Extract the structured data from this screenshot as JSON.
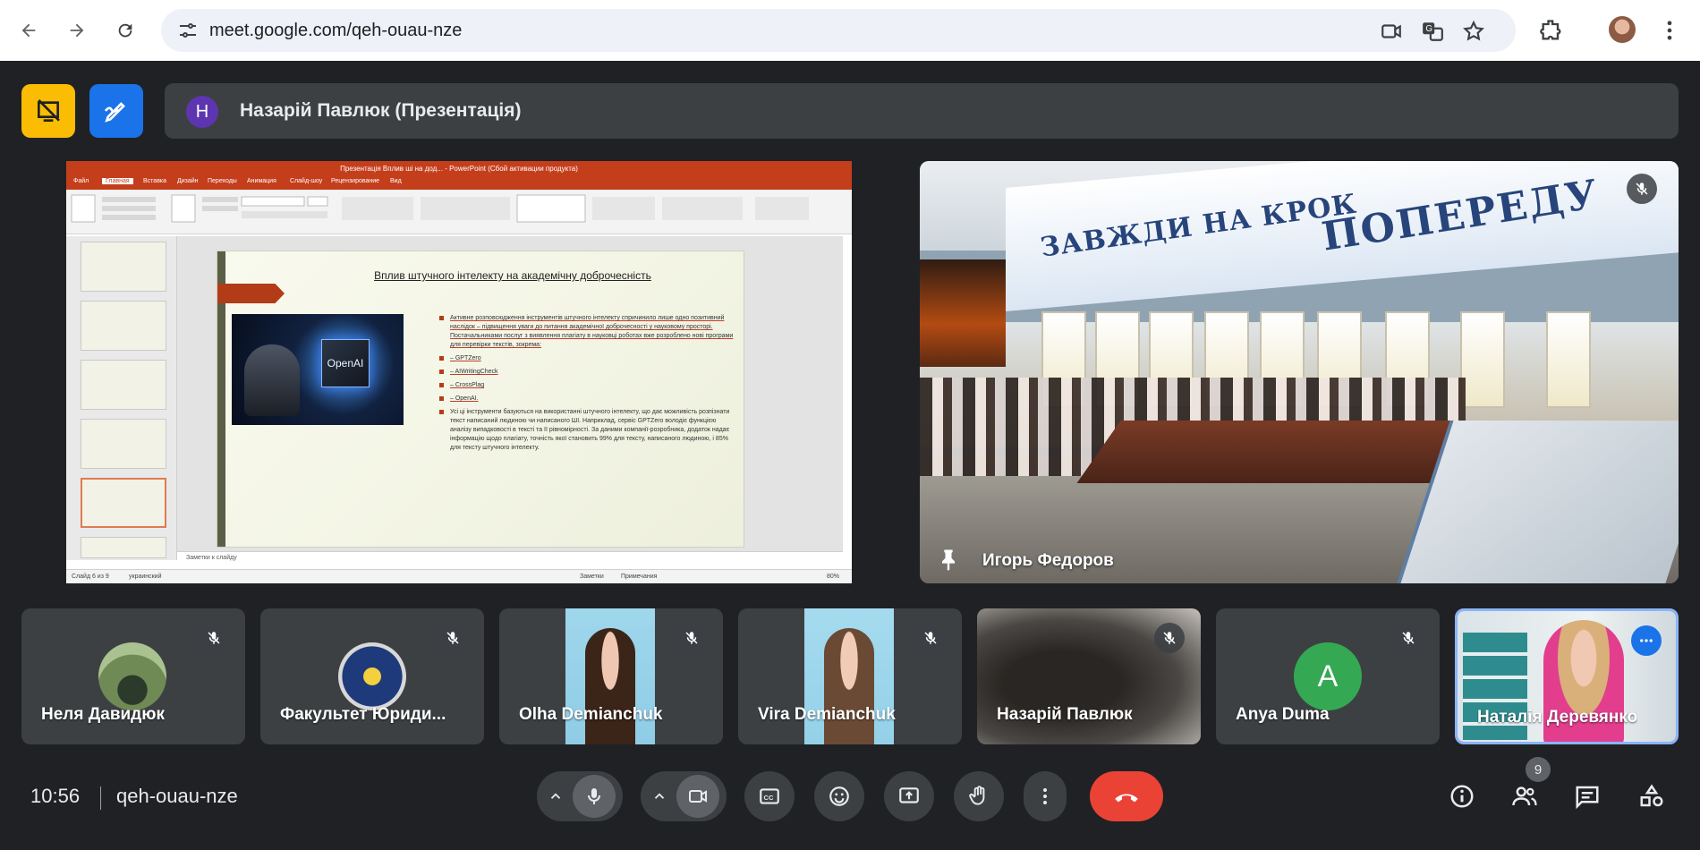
{
  "browser": {
    "url": "meet.google.com/qeh-ouau-nze",
    "icons": [
      "back-arrow",
      "forward-arrow",
      "reload",
      "site-settings",
      "camera",
      "translate",
      "bookmark-star",
      "extensions",
      "profile",
      "menu-dots"
    ]
  },
  "meet_top": {
    "presenter_initial": "Н",
    "presenter_label": "Назарій Павлюк (Презентація)",
    "button_colors": {
      "sideboard": "#fbbc04",
      "edit": "#1a73e8"
    }
  },
  "presentation": {
    "window_title": "Презентація Вплив ші на дод... - PowerPoint (Сбой активации продукта)",
    "tabs": [
      "Файл",
      "Главная",
      "Вставка",
      "Дизайн",
      "Переходы",
      "Анимация",
      "Слайд-шоу",
      "Рецензирование",
      "Вид"
    ],
    "slide_title": "Вплив штучного інтелекту на академічну доброчесність",
    "image_label": "OpenAI",
    "bullets": [
      "Активне розповсюдження інструментів штучного інтелекту спричинило лише одно позитивний наслідок – підвищення уваги до питання академічної доброчесності у науковому просторі. Постачальниками послуг з виявлення плагіату в науковці роботах вже розроблено нові програми для перевірки текстів, зокрема:",
      "– GPTZero",
      "– AIWritingCheck",
      "– CrossPlag",
      "– OpenAI.",
      "Усі ці інструменти базуються на використанні штучного інтелекту, що дає можливість розпізнати текст написаний людиною чи написаного ШІ. Наприклад, сервіс GPTZero володіє функцією аналізу випадковості в тексті та її рівномірності. За даними компанії-розробника, додаток надає інформацію щодо плагіату, точність якої становить 99% для тексту, написаного людиною, і 85% для тексту штучного інтелекту."
    ],
    "notes_placeholder": "Заметки к слайду",
    "status_left": "Слайд 6 из 9",
    "status_lang": "украинский",
    "status_notes": "Заметки",
    "status_comments": "Примечания",
    "zoom": "80%"
  },
  "camera": {
    "participant": "Игорь Федоров",
    "banner_line1": "ЗАВЖДИ НА КРОК",
    "banner_line2": "ПОПЕРЕДУ"
  },
  "participants": [
    {
      "name": "Неля Давидюк",
      "type": "photo-avatar"
    },
    {
      "name": "Факультет Юриди...",
      "type": "emblem-avatar"
    },
    {
      "name": "Olha Demianchuk",
      "type": "video"
    },
    {
      "name": "Vira Demianchuk",
      "type": "video"
    },
    {
      "name": "Назарій Павлюк",
      "type": "video-dark"
    },
    {
      "name": "Anya Duma",
      "type": "letter",
      "initial": "A",
      "color": "#34a853"
    },
    {
      "name": "Наталія Деревянко",
      "type": "video-active"
    }
  ],
  "bottom": {
    "time": "10:56",
    "meeting_code": "qeh-ouau-nze",
    "people_count": "9",
    "hangup_color": "#ea4335"
  }
}
